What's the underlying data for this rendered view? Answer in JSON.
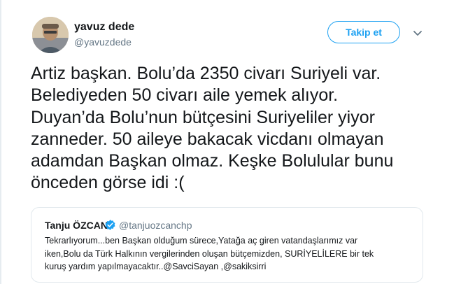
{
  "tweet": {
    "author": {
      "name": "yavuz dede",
      "handle": "@yavuzdede"
    },
    "follow_label": "Takip et",
    "text": "Artiz başkan. Bolu’da 2350 civarı Suriyeli var.\nBelediyeden 50 civarı aile yemek alıyor.\nDuyan’da Bolu’nun bütçesini Suriyeliler yiyor\nzanneder. 50 aileye bakacak vicdanı olmayan\nadamdan Başkan olmaz. Keşke Bolulular bunu\nönceden görse idi :(",
    "quoted": {
      "name": "Tanju ÖZCAN",
      "handle": "@tanjuozcanchp",
      "text": "Tekrarlıyorum...ben Başkan olduğum sürece,Yatağa aç giren vatandaşlarımız var\niken,Bolu da Türk Halkının vergilerinden oluşan bütçemizden, SURİYELİLERE bir tek\nkuruş yardım yapılmayacaktır..@SavciSayan ,@sakiksirri"
    }
  },
  "colors": {
    "accent": "#1da1f2",
    "secondary_text": "#657786",
    "border": "#e1e8ed"
  },
  "icons": {
    "caret": "chevron-down-icon",
    "verified": "verified-badge-icon"
  }
}
